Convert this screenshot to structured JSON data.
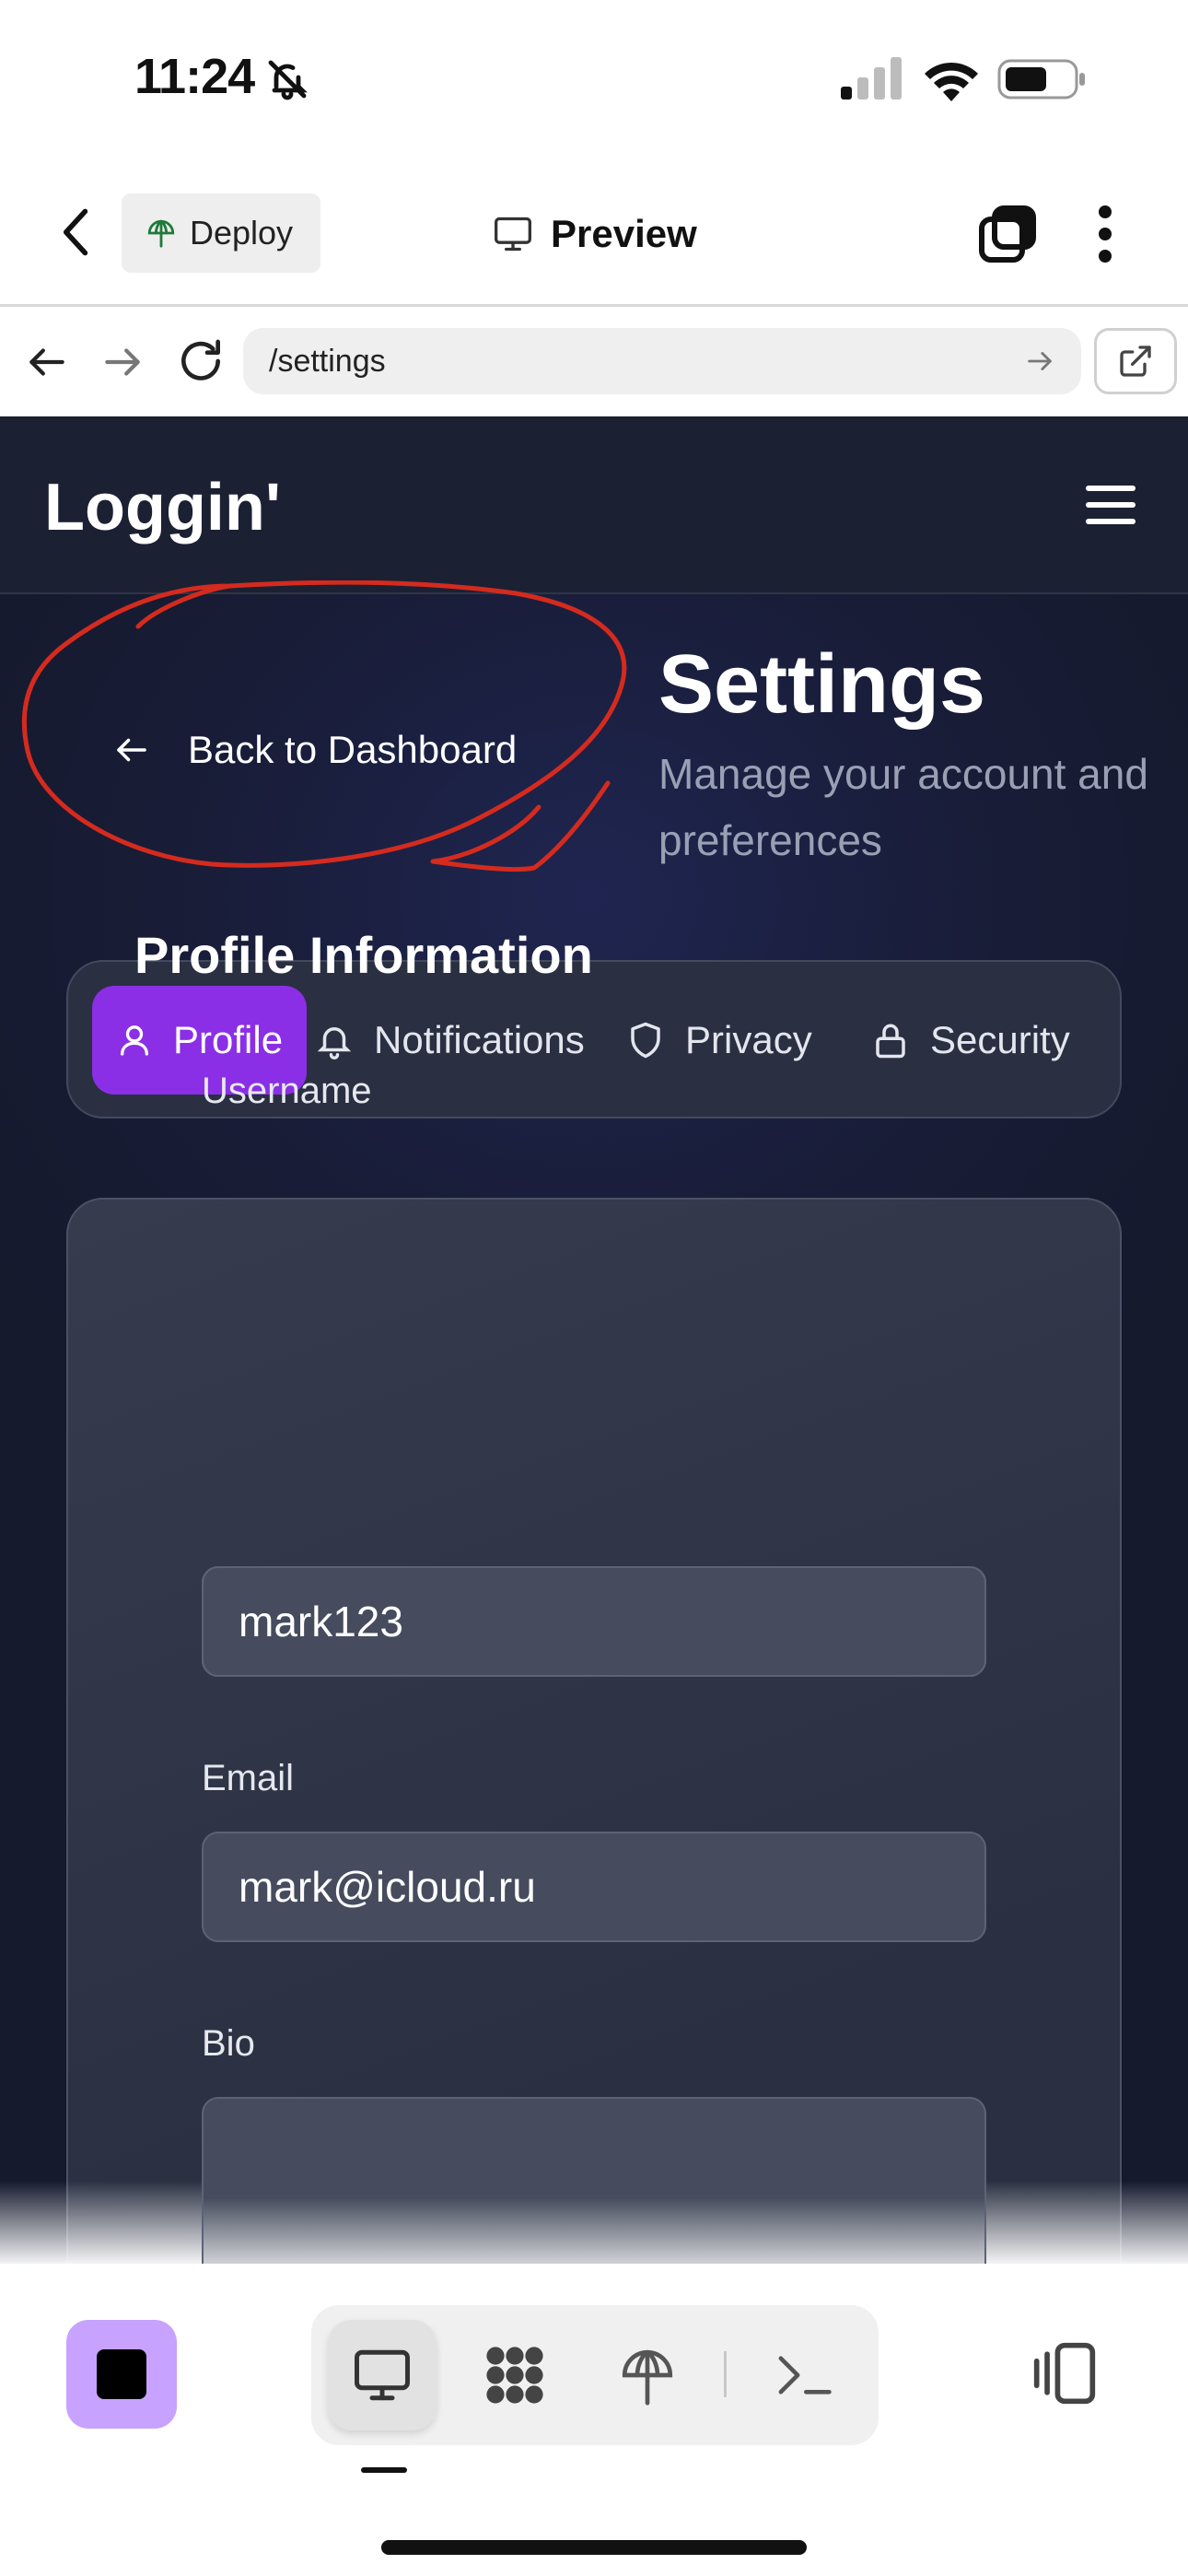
{
  "status_bar": {
    "time": "11:24",
    "icons": [
      "bell-slash-icon",
      "cellular-signal-icon",
      "wifi-icon",
      "battery-icon"
    ]
  },
  "app_bar": {
    "deploy_label": "Deploy",
    "preview_label": "Preview",
    "icons": [
      "chevron-left-icon",
      "deploy-tree-icon",
      "monitor-icon",
      "tabs-icon",
      "more-vertical-icon"
    ]
  },
  "browser": {
    "url": "/settings",
    "icons": [
      "arrow-left-icon",
      "arrow-right-icon",
      "reload-icon",
      "go-arrow-icon",
      "external-link-icon"
    ]
  },
  "site": {
    "logo": "Loggin'",
    "back_link": "Back to Dashboard",
    "title": "Settings",
    "subtitle": "Manage your account and preferences",
    "tabs": [
      {
        "label": "Profile",
        "icon": "user-icon",
        "active": true
      },
      {
        "label": "Notifications",
        "icon": "bell-icon",
        "active": false
      },
      {
        "label": "Privacy",
        "icon": "shield-icon",
        "active": false
      },
      {
        "label": "Security",
        "icon": "lock-icon",
        "active": false
      }
    ],
    "profile": {
      "heading": "Profile Information",
      "username_label": "Username",
      "username_value": "mark123",
      "email_label": "Email",
      "email_value": "mark@icloud.ru",
      "bio_label": "Bio",
      "bio_value": ""
    },
    "accent_color": "#8b2fe6",
    "annotation_color": "#d42b1e"
  },
  "bottom_toolbar": {
    "stop_color": "#c7a2ff",
    "segments": [
      "monitor-icon",
      "flower-grid-icon",
      "deploy-tree-icon",
      "terminal-icon"
    ],
    "active_segment": "monitor-icon",
    "right_icon": "device-rotate-icon"
  }
}
